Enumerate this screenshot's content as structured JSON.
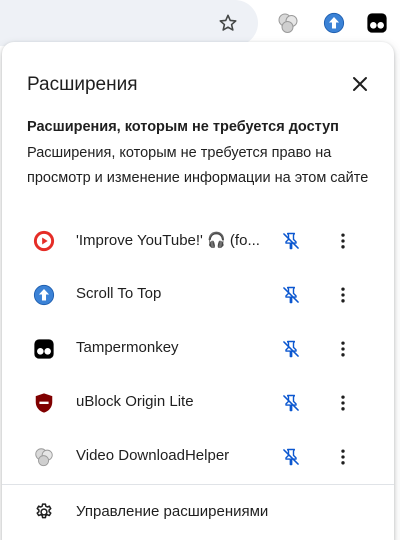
{
  "toolbar": {
    "icons": [
      "star-icon",
      "video-downloadhelper-icon",
      "scroll-to-top-icon",
      "tampermonkey-icon"
    ]
  },
  "popup": {
    "title": "Расширения",
    "close_icon": "close-icon",
    "section": {
      "heading": "Расширения, которым не требуется доступ",
      "description": "Расширения, которым не требуется право на просмотр и изменение информации на этом сайте"
    },
    "extensions": [
      {
        "name": "'Improve YouTube!' 🎧 (fo...",
        "icon": "improve-youtube-icon",
        "pin_icon": "pin-off-icon",
        "menu_icon": "more-vert-icon"
      },
      {
        "name": "Scroll To Top",
        "icon": "scroll-to-top-icon",
        "pin_icon": "pin-off-icon",
        "menu_icon": "more-vert-icon"
      },
      {
        "name": "Tampermonkey",
        "icon": "tampermonkey-icon",
        "pin_icon": "pin-off-icon",
        "menu_icon": "more-vert-icon"
      },
      {
        "name": "uBlock Origin Lite",
        "icon": "ublock-origin-lite-icon",
        "pin_icon": "pin-off-icon",
        "menu_icon": "more-vert-icon"
      },
      {
        "name": "Video DownloadHelper",
        "icon": "video-downloadhelper-icon",
        "pin_icon": "pin-off-icon",
        "menu_icon": "more-vert-icon"
      }
    ],
    "manage": {
      "label": "Управление расширениями",
      "icon": "gear-icon"
    }
  },
  "colors": {
    "accent_blue": "#0b57d0",
    "improve_youtube_red": "#e52d27",
    "scroll_to_top_blue": "#3b82d6",
    "ublock_red": "#800000",
    "omnibox_bg": "#eef1f6"
  }
}
